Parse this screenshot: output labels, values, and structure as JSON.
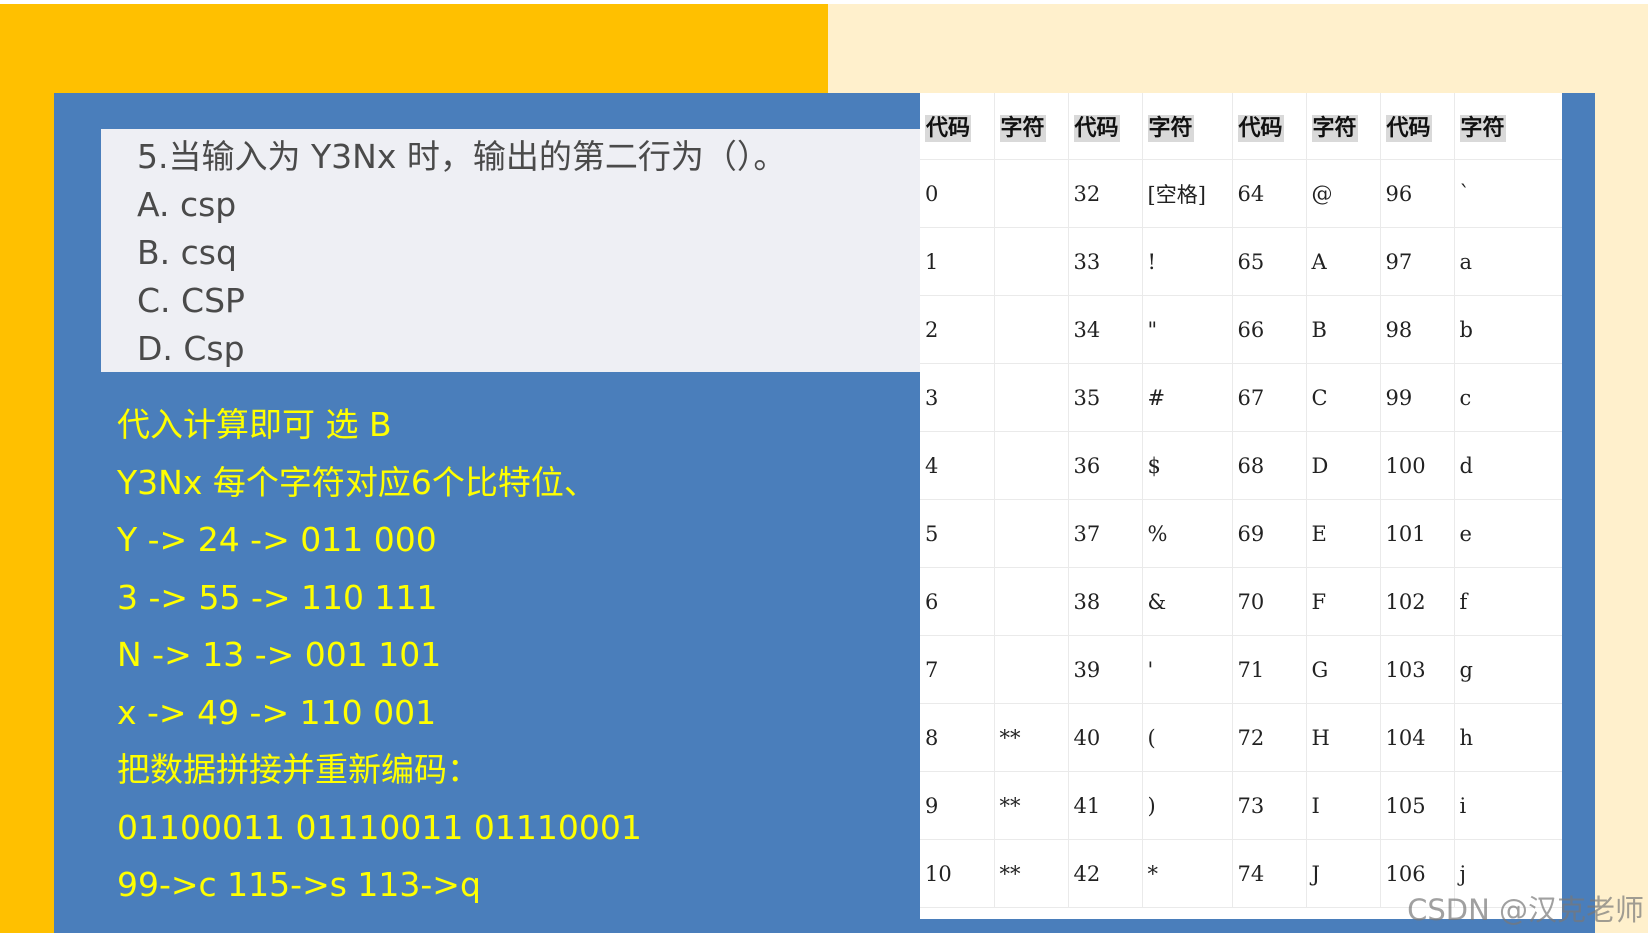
{
  "question": {
    "stem": "5.当输入为 Y3Nx 时，输出的第二行为（）。",
    "options": [
      "A. csp",
      "B. csq",
      "C. CSP",
      "D. Csp"
    ]
  },
  "solution": {
    "lines": [
      "代入计算即可   选 B",
      "Y3Nx 每个字符对应6个比特位、",
      "Y -> 24 -> 011 000",
      "3 -> 55 -> 110 111",
      "N -> 13 -> 001 101",
      "x -> 49 -> 110 001",
      "把数据拼接并重新编码：",
      "01100011 01110011 01110001",
      "99->c 115->s 113->q"
    ]
  },
  "ascii_table": {
    "headers": [
      "代码",
      "字符",
      "代码",
      "字符",
      "代码",
      "字符",
      "代码",
      "字符"
    ],
    "rows": [
      [
        "0",
        "",
        "32",
        "[空格]",
        "64",
        "@",
        "96",
        "`"
      ],
      [
        "1",
        "",
        "33",
        "!",
        "65",
        "A",
        "97",
        "a"
      ],
      [
        "2",
        "",
        "34",
        "\"",
        "66",
        "B",
        "98",
        "b"
      ],
      [
        "3",
        "",
        "35",
        "#",
        "67",
        "C",
        "99",
        "c"
      ],
      [
        "4",
        "",
        "36",
        "$",
        "68",
        "D",
        "100",
        "d"
      ],
      [
        "5",
        "",
        "37",
        "%",
        "69",
        "E",
        "101",
        "e"
      ],
      [
        "6",
        "",
        "38",
        "&",
        "70",
        "F",
        "102",
        "f"
      ],
      [
        "7",
        "",
        "39",
        "'",
        "71",
        "G",
        "103",
        "g"
      ],
      [
        "8",
        "**",
        "40",
        "(",
        "72",
        "H",
        "104",
        "h"
      ],
      [
        "9",
        "**",
        "41",
        ")",
        "73",
        "I",
        "105",
        "i"
      ],
      [
        "10",
        "**",
        "42",
        "*",
        "74",
        "J",
        "106",
        "j"
      ]
    ]
  },
  "watermark": "CSDN @汉克老师",
  "colors": {
    "orange_bg": "#ffc000",
    "cream_bg": "#fff0cc",
    "blue_panel": "#4a7ebb",
    "answer_text": "#ffff00"
  }
}
